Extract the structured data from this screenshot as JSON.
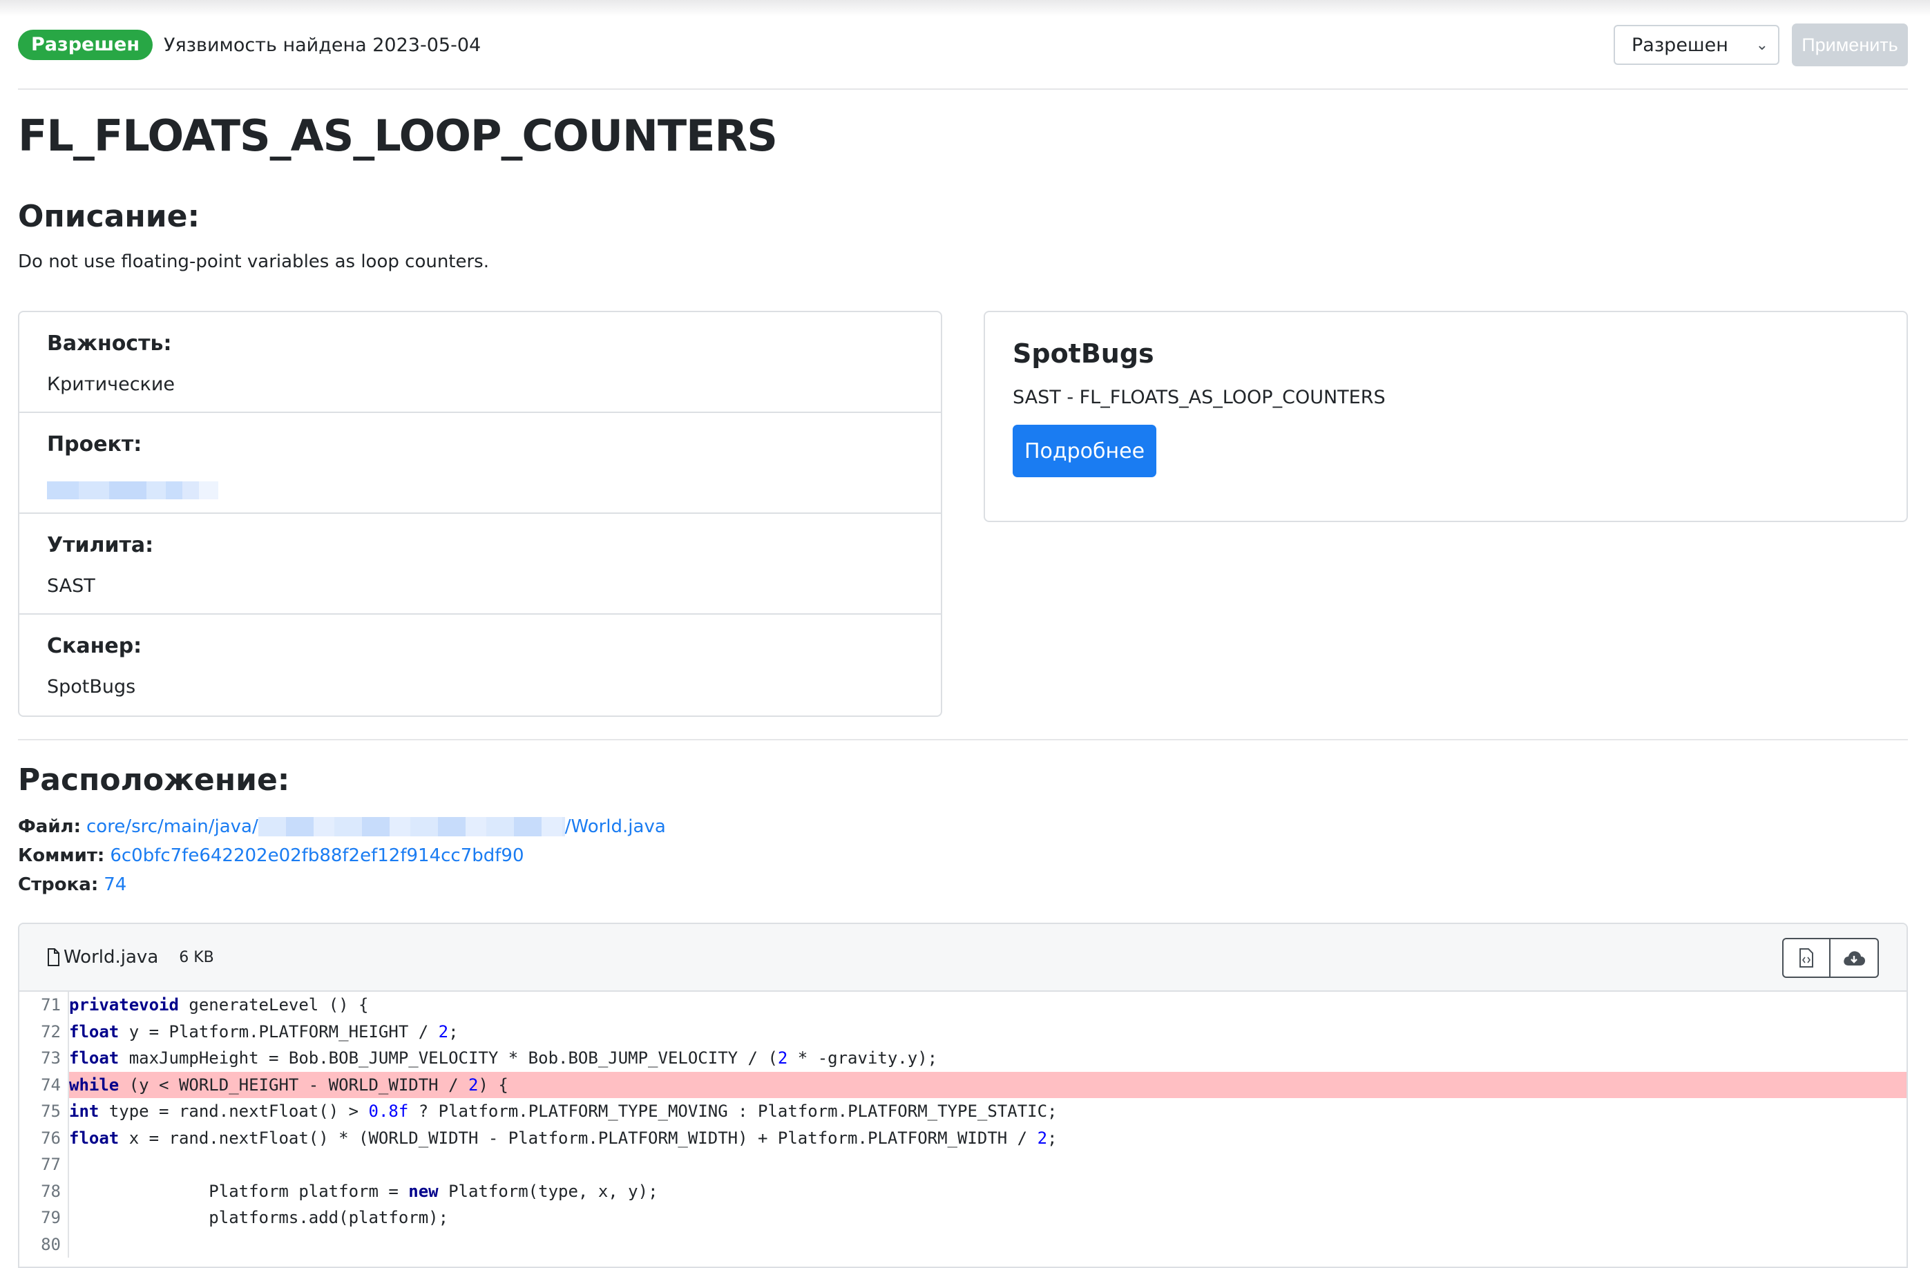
{
  "header": {
    "status_badge": "Разрешен",
    "found_text": "Уязвимость найдена 2023-05-04",
    "status_select_value": "Разрешен",
    "apply_label": "Применить"
  },
  "title": "FL_FLOATS_AS_LOOP_COUNTERS",
  "description": {
    "heading": "Описание:",
    "text": "Do not use floating-point variables as loop counters."
  },
  "details": {
    "severity_label": "Важность:",
    "severity_value": "Критические",
    "project_label": "Проект:",
    "tool_label": "Утилита:",
    "tool_value": "SAST",
    "scanner_label": "Сканер:",
    "scanner_value": "SpotBugs"
  },
  "rule_card": {
    "title": "SpotBugs",
    "subtitle": "SAST - FL_FLOATS_AS_LOOP_COUNTERS",
    "more_label": "Подробнее"
  },
  "location": {
    "heading": "Расположение:",
    "file_label": "Файл:",
    "file_path_prefix": "core/src/main/java/",
    "file_path_suffix": "/World.java",
    "commit_label": "Коммит:",
    "commit_value": "6c0bfc7fe642202e02fb88f2ef12f914cc7bdf90",
    "line_label": "Строка:",
    "line_value": "74"
  },
  "file_viewer": {
    "file_name": "World.java",
    "file_size": "6 KB",
    "highlighted_line": 74,
    "lines": [
      {
        "n": "71",
        "code": "    private void generateLevel () {"
      },
      {
        "n": "72",
        "code": "        float y = Platform.PLATFORM_HEIGHT / 2;"
      },
      {
        "n": "73",
        "code": "        float maxJumpHeight = Bob.BOB_JUMP_VELOCITY * Bob.BOB_JUMP_VELOCITY / (2 * -gravity.y);"
      },
      {
        "n": "74",
        "code": "        while (y < WORLD_HEIGHT - WORLD_WIDTH / 2) {"
      },
      {
        "n": "75",
        "code": "            int type = rand.nextFloat() > 0.8f ? Platform.PLATFORM_TYPE_MOVING : Platform.PLATFORM_TYPE_STATIC;"
      },
      {
        "n": "76",
        "code": "            float x = rand.nextFloat() * (WORLD_WIDTH - Platform.PLATFORM_WIDTH) + Platform.PLATFORM_WIDTH / 2;"
      },
      {
        "n": "77",
        "code": ""
      },
      {
        "n": "78",
        "code": "            Platform platform = new Platform(type, x, y);"
      },
      {
        "n": "79",
        "code": "            platforms.add(platform);"
      },
      {
        "n": "80",
        "code": ""
      }
    ]
  },
  "colors": {
    "success": "#28a745",
    "primary": "#1a7cf2",
    "highlight": "#ffbfc3"
  }
}
